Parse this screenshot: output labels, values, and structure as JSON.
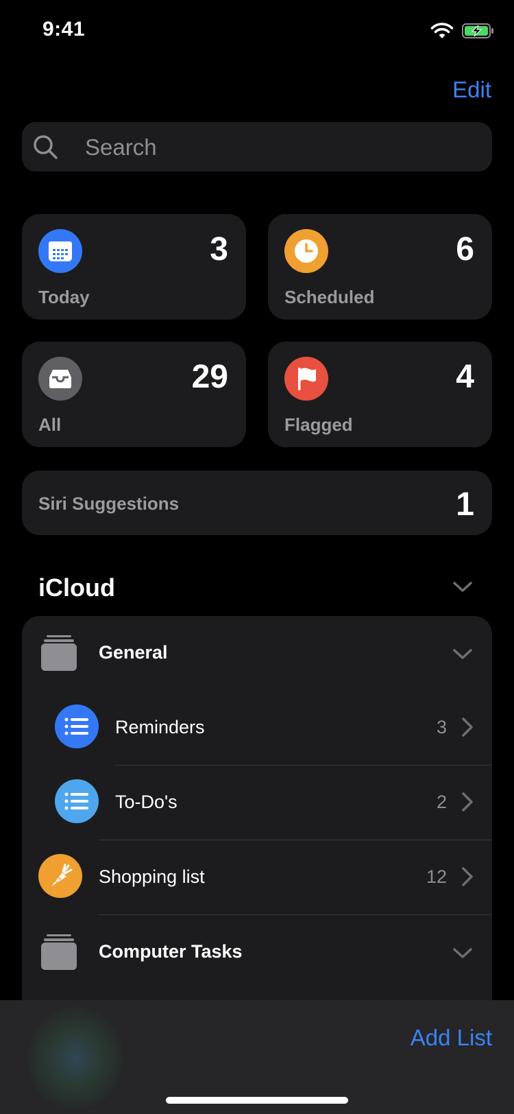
{
  "status_bar": {
    "time": "9:41"
  },
  "header": {
    "edit_label": "Edit"
  },
  "search": {
    "placeholder": "Search"
  },
  "smart_lists": [
    {
      "label": "Today",
      "count": "3",
      "icon": "calendar-icon",
      "color": "#3478f6"
    },
    {
      "label": "Scheduled",
      "count": "6",
      "icon": "clock-icon",
      "color": "#f0a030"
    },
    {
      "label": "All",
      "count": "29",
      "icon": "tray-icon",
      "color": "#5f5f64"
    },
    {
      "label": "Flagged",
      "count": "4",
      "icon": "flag-icon",
      "color": "#e8503f"
    }
  ],
  "siri": {
    "label": "Siri Suggestions",
    "count": "1"
  },
  "icloud": {
    "title": "iCloud",
    "rows": [
      {
        "type": "group",
        "label": "General",
        "icon": "folder-icon"
      },
      {
        "type": "list",
        "label": "Reminders",
        "count": "3",
        "icon": "list-icon",
        "color": "#3478f6"
      },
      {
        "type": "list",
        "label": "To-Do's",
        "count": "2",
        "icon": "list-icon",
        "color": "#4ea7ee"
      },
      {
        "type": "list",
        "label": "Shopping list",
        "count": "12",
        "icon": "carrot-icon",
        "color": "#f0a030"
      },
      {
        "type": "group",
        "label": "Computer Tasks",
        "icon": "folder-icon"
      }
    ]
  },
  "footer": {
    "add_list_label": "Add List"
  },
  "colors": {
    "accent": "#3b82f6",
    "card_bg": "#1c1c1e",
    "secondary_text": "#8e8e93"
  }
}
